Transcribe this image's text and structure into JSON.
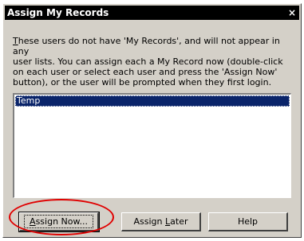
{
  "window": {
    "title": "Assign My Records",
    "close_label": "×"
  },
  "message": {
    "line1_pre": "",
    "line1_hotkey": "T",
    "line1_post": "hese users do not have 'My Records', and will not appear in any",
    "line2": "user lists.  You can assign each a My Record now (double-click",
    "line3": "on each user or select each user and press the 'Assign Now'",
    "line4": "button), or the user will be prompted when they first login."
  },
  "users": {
    "items": [
      "Temp"
    ],
    "selected": "Temp"
  },
  "buttons": {
    "assign_now": {
      "pre": "",
      "hotkey": "A",
      "post": "ssign Now..."
    },
    "assign_later": {
      "pre": "Assign ",
      "hotkey": "L",
      "post": "ater"
    },
    "help": {
      "label": "Help"
    }
  },
  "annotation": {
    "color": "#e00000",
    "highlight": "assign-now-button"
  }
}
